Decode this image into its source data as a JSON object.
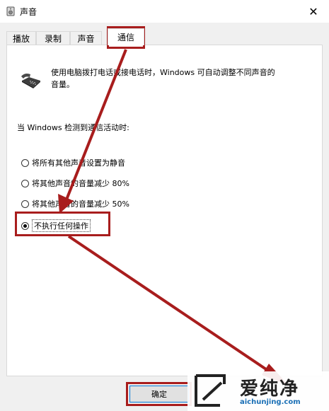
{
  "window": {
    "title": "声音",
    "close_symbol": "✕"
  },
  "tabs": [
    {
      "label": "播放"
    },
    {
      "label": "录制"
    },
    {
      "label": "声音"
    },
    {
      "label": "通信",
      "active": true
    }
  ],
  "panel": {
    "description": "使用电脑拨打电话或接电话时，Windows 可自动调整不同声音的音量。",
    "when_label": "当 Windows 检测到通信活动时:",
    "options": [
      {
        "label": "将所有其他声音设置为静音",
        "checked": false
      },
      {
        "label": "将其他声音的音量减少 80%",
        "checked": false
      },
      {
        "label": "将其他声音的音量减少 50%",
        "checked": false
      },
      {
        "label": "不执行任何操作",
        "checked": true
      }
    ]
  },
  "buttons": {
    "ok_label": "确定"
  },
  "watermark": {
    "title": "爱纯净",
    "url": "aichunjing.com"
  },
  "colors": {
    "highlight": "#a81d1d",
    "focus_border": "#0078d7",
    "watermark_url": "#1a6fb5"
  }
}
